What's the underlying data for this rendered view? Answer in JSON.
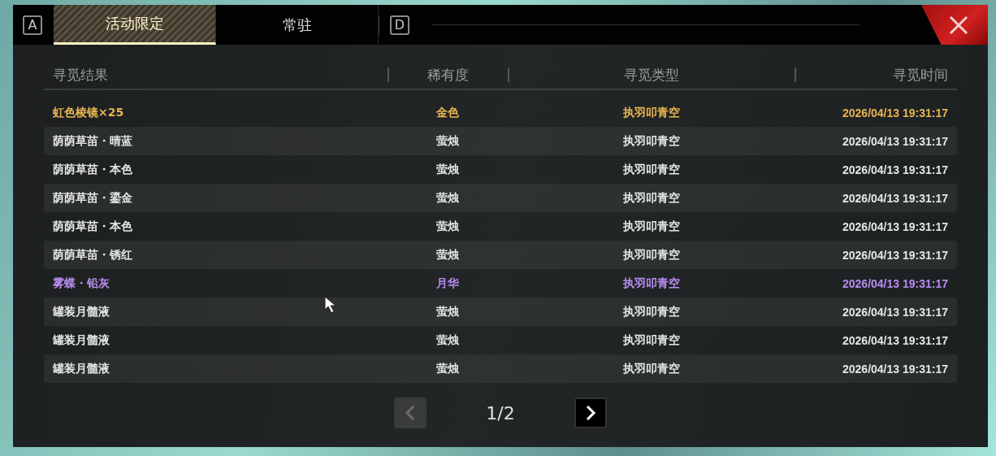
{
  "tabs": {
    "prev_key": "A",
    "next_key": "D",
    "items": [
      {
        "label": "活动限定",
        "selected": true
      },
      {
        "label": "常驻",
        "selected": false
      }
    ]
  },
  "table": {
    "columns": [
      "寻觅结果",
      "稀有度",
      "寻觅类型",
      "寻觅时间"
    ],
    "rows": [
      {
        "color": "#e8b552",
        "cells": [
          "虹色棱镜×25",
          "金色",
          "执羽叩青空",
          "2026/04/13 19:31:17"
        ]
      },
      {
        "color": "#e4e6e6",
        "cells": [
          "荫荫草苗・晴蓝",
          "萤烛",
          "执羽叩青空",
          "2026/04/13 19:31:17"
        ]
      },
      {
        "color": "#e4e6e6",
        "cells": [
          "荫荫草苗・本色",
          "萤烛",
          "执羽叩青空",
          "2026/04/13 19:31:17"
        ]
      },
      {
        "color": "#e4e6e6",
        "cells": [
          "荫荫草苗・鎏金",
          "萤烛",
          "执羽叩青空",
          "2026/04/13 19:31:17"
        ]
      },
      {
        "color": "#e4e6e6",
        "cells": [
          "荫荫草苗・本色",
          "萤烛",
          "执羽叩青空",
          "2026/04/13 19:31:17"
        ]
      },
      {
        "color": "#e4e6e6",
        "cells": [
          "荫荫草苗・锈红",
          "萤烛",
          "执羽叩青空",
          "2026/04/13 19:31:17"
        ]
      },
      {
        "color": "#b98cf0",
        "cells": [
          "雾蝶・铅灰",
          "月华",
          "执羽叩青空",
          "2026/04/13 19:31:17"
        ]
      },
      {
        "color": "#e4e6e6",
        "cells": [
          "罐装月髓液",
          "萤烛",
          "执羽叩青空",
          "2026/04/13 19:31:17"
        ]
      },
      {
        "color": "#e4e6e6",
        "cells": [
          "罐装月髓液",
          "萤烛",
          "执羽叩青空",
          "2026/04/13 19:31:17"
        ]
      },
      {
        "color": "#e4e6e6",
        "cells": [
          "罐装月髓液",
          "萤烛",
          "执羽叩青空",
          "2026/04/13 19:31:17"
        ]
      }
    ]
  },
  "pager": {
    "page": "1/2",
    "prev_disabled": true,
    "next_disabled": false
  }
}
